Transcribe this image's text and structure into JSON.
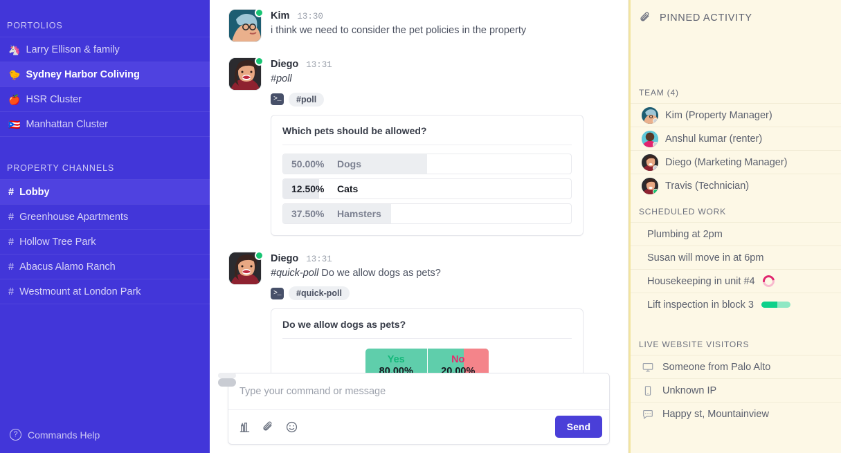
{
  "sidebar": {
    "sections": [
      {
        "title": "PORTOLIOS",
        "items": [
          {
            "emoji": "🦄",
            "label": "Larry Ellison & family",
            "active": false
          },
          {
            "emoji": "🐤",
            "label": "Sydney Harbor Coliving",
            "active": true
          },
          {
            "emoji": "🍎",
            "label": "HSR Cluster",
            "active": false
          },
          {
            "emoji": "🇵🇷",
            "label": "Manhattan Cluster",
            "active": false
          }
        ]
      },
      {
        "title": "PROPERTY CHANNELS",
        "items": [
          {
            "hash": "#",
            "label": "Lobby",
            "active": true
          },
          {
            "hash": "#",
            "label": "Greenhouse Apartments",
            "active": false
          },
          {
            "hash": "#",
            "label": "Hollow Tree Park",
            "active": false
          },
          {
            "hash": "#",
            "label": "Abacus Alamo Ranch",
            "active": false
          },
          {
            "hash": "#",
            "label": "Westmount at London Park",
            "active": false
          }
        ]
      }
    ],
    "help_label": "Commands Help",
    "help_icon": "question-circle-icon",
    "accent": "#4236d9",
    "active_bg": "#4f42e0"
  },
  "messages": [
    {
      "name": "Kim",
      "time": "13:30",
      "text": "i think we need to consider the pet policies in the property",
      "online": true,
      "avatar_style": "kim"
    },
    {
      "name": "Diego",
      "time": "13:31",
      "command_text": "#poll",
      "chip_icon": "terminal-icon",
      "chip_label": "#poll",
      "online": true,
      "avatar_style": "diego",
      "poll": {
        "question": "Which pets should be allowed?",
        "options": [
          {
            "label": "Dogs",
            "percent": "50.00%",
            "value": 50.0,
            "selected": false
          },
          {
            "label": "Cats",
            "percent": "12.50%",
            "value": 12.5,
            "selected": true
          },
          {
            "label": "Hamsters",
            "percent": "37.50%",
            "value": 37.5,
            "selected": false
          }
        ]
      }
    },
    {
      "name": "Diego",
      "time": "13:31",
      "command_text": "#quick-poll",
      "trailing_text": " Do we allow dogs as pets?",
      "chip_icon": "terminal-icon",
      "chip_label": "#quick-poll",
      "online": true,
      "avatar_style": "diego",
      "quick_poll": {
        "question": "Do we allow dogs as pets?",
        "yes_label": "Yes",
        "yes_percent": "80.00%",
        "yes_value": 80.0,
        "no_label": "No",
        "no_percent": "20.00%",
        "no_value": 20.0,
        "yes_color": "#5fceab",
        "no_color": "#f4848a"
      }
    }
  ],
  "composer": {
    "placeholder": "Type your command or message",
    "value": "",
    "send_label": "Send",
    "tools": [
      {
        "name": "chart-icon"
      },
      {
        "name": "paperclip-icon"
      },
      {
        "name": "smiley-icon"
      }
    ]
  },
  "right_panel": {
    "pinned_title": "PINNED ACTIVITY",
    "pinned_icon": "paperclip-icon",
    "team": {
      "title": "TEAM (4)",
      "members": [
        {
          "label": "Kim (Property Manager)",
          "online": false,
          "avatar_style": "kim"
        },
        {
          "label": "Anshul kumar (renter)",
          "online": false,
          "avatar_style": "anshul"
        },
        {
          "label": "Diego (Marketing Manager)",
          "online": false,
          "avatar_style": "diego"
        },
        {
          "label": "Travis (Technician)",
          "online": true,
          "avatar_style": "travis"
        }
      ]
    },
    "scheduled": {
      "title": "SCHEDULED WORK",
      "items": [
        {
          "label": "Plumbing at 2pm",
          "indicator": "none"
        },
        {
          "label": "Susan will move in at 6pm",
          "indicator": "none"
        },
        {
          "label": "Housekeeping in unit #4",
          "indicator": "spinner"
        },
        {
          "label": "Lift inspection in block 3",
          "indicator": "progress",
          "progress": 55
        }
      ]
    },
    "visitors": {
      "title": "LIVE WEBSITE VISITORS",
      "items": [
        {
          "label": "Someone from Palo Alto",
          "icon": "desktop-icon"
        },
        {
          "label": "Unknown IP",
          "icon": "mobile-icon"
        },
        {
          "label": "Happy st, Mountainview",
          "icon": "chat-bubble-icon"
        }
      ]
    },
    "bg": "#fdf8e6"
  }
}
